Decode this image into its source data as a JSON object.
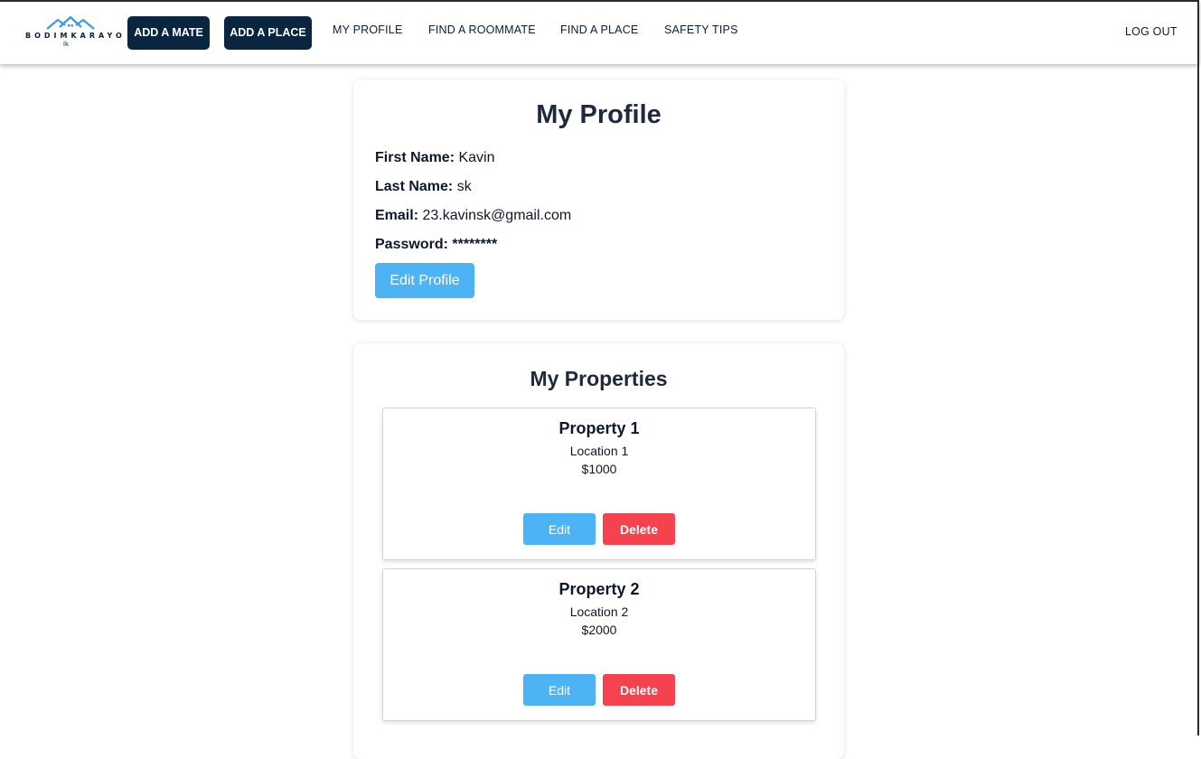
{
  "navbar": {
    "logo_text": "BODIMKARAYO",
    "logo_sub": "lk",
    "add_mate_label": "ADD A MATE",
    "add_place_label": "ADD A PLACE",
    "links": {
      "my_profile": "MY PROFILE",
      "find_roommate": "FIND A ROOMMATE",
      "find_place": "FIND A PLACE",
      "safety_tips": "SAFETY TIPS"
    },
    "logout_label": "LOG OUT"
  },
  "profile": {
    "title": "My Profile",
    "first_name_label": "First Name:",
    "first_name": "Kavin",
    "last_name_label": "Last Name:",
    "last_name": "sk",
    "email_label": "Email:",
    "email": "23.kavinsk@gmail.com",
    "password_label": "Password:",
    "password": "********",
    "edit_button": "Edit Profile"
  },
  "properties": {
    "title": "My Properties",
    "items": [
      {
        "name": "Property 1",
        "location": "Location 1",
        "price": "$1000",
        "edit_label": "Edit",
        "delete_label": "Delete"
      },
      {
        "name": "Property 2",
        "location": "Location 2",
        "price": "$2000",
        "edit_label": "Edit",
        "delete_label": "Delete"
      }
    ]
  },
  "colors": {
    "nav_button_bg": "#0a2540",
    "primary_button": "#4cb3f5",
    "danger_button": "#f5424e",
    "logo_roof": "#3b9ede"
  },
  "icons": {
    "logo": "house-roofs-logo-icon"
  }
}
